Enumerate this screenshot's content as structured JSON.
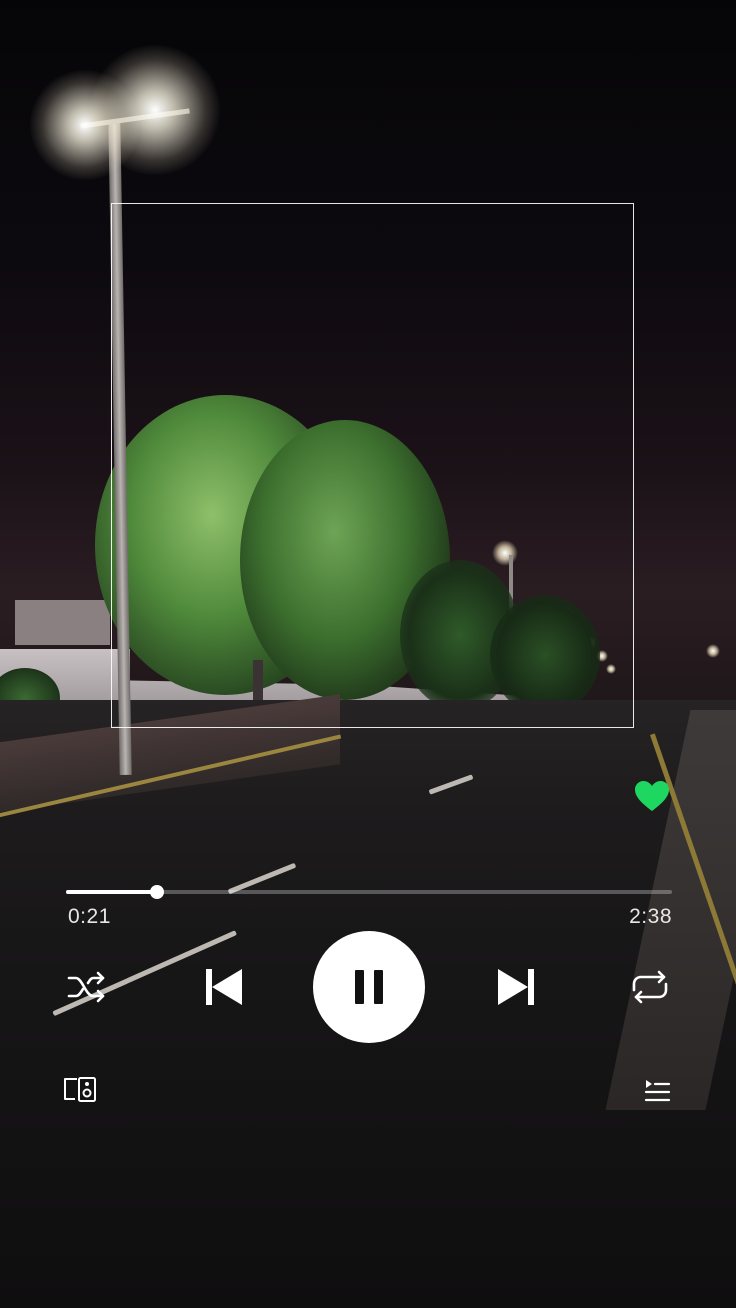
{
  "player": {
    "elapsed": "0:21",
    "duration": "2:38",
    "progress_fraction": 0.15,
    "is_playing": true,
    "liked": true
  },
  "colors": {
    "accent_green": "#1ed760",
    "control_white": "#ffffff",
    "track_inactive": "rgba(255,255,255,0.28)"
  },
  "icons": {
    "like": "heart-icon",
    "shuffle": "shuffle-icon",
    "previous": "skip-previous-icon",
    "play_pause": "pause-icon",
    "next": "skip-next-icon",
    "repeat": "repeat-icon",
    "devices": "devices-icon",
    "queue": "queue-icon"
  }
}
